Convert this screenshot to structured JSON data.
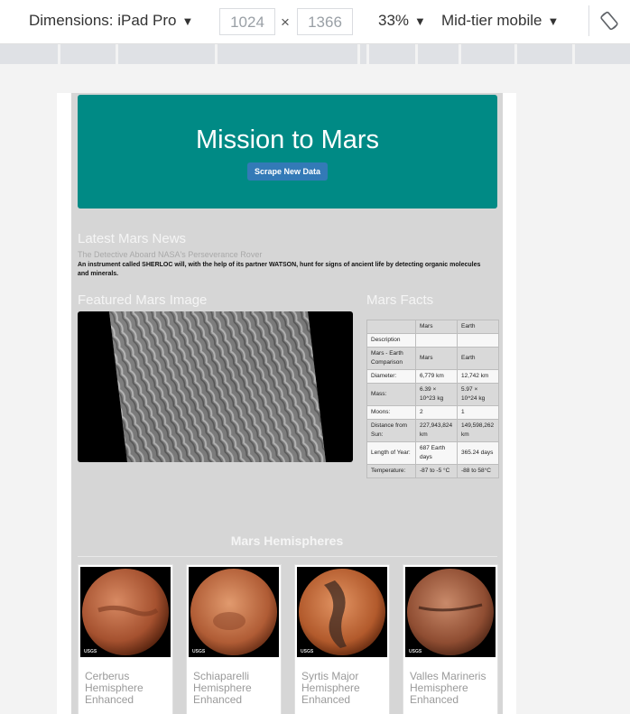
{
  "toolbar": {
    "dimensions_label": "Dimensions: iPad Pro",
    "width_value": "1024",
    "times_symbol": "×",
    "height_value": "1366",
    "zoom": "33%",
    "throttle": "Mid-tier mobile",
    "icons": {
      "dropdown": "chevron-down-icon",
      "rotate": "rotate-icon"
    }
  },
  "page": {
    "title": "Mission to Mars",
    "scrape_button": "Scrape New Data",
    "colors": {
      "jumbotron": "#008a85",
      "button": "#337ab7",
      "panel": "#d6d6d6"
    },
    "news": {
      "heading": "Latest Mars News",
      "title": "The Detective Aboard NASA's Perseverance Rover",
      "paragraph": "An instrument called SHERLOC will, with the help of its partner WATSON, hunt for signs of ancient life by detecting organic molecules and minerals."
    },
    "featured": {
      "heading": "Featured Mars Image"
    },
    "facts": {
      "heading": "Mars Facts",
      "columns": [
        "",
        "Mars",
        "Earth"
      ],
      "rows": [
        [
          "Description",
          "",
          ""
        ],
        [
          "Mars - Earth Comparison",
          "Mars",
          "Earth"
        ],
        [
          "Diameter:",
          "6,779 km",
          "12,742 km"
        ],
        [
          "Mass:",
          "6.39 × 10^23 kg",
          "5.97 × 10^24 kg"
        ],
        [
          "Moons:",
          "2",
          "1"
        ],
        [
          "Distance from Sun:",
          "227,943,824 km",
          "149,598,262 km"
        ],
        [
          "Length of Year:",
          "687 Earth days",
          "365.24 days"
        ],
        [
          "Temperature:",
          "-87 to -5 °C",
          "-88 to 58°C"
        ]
      ]
    },
    "hemispheres": {
      "heading": "Mars Hemispheres",
      "items": [
        {
          "title": "Cerberus Hemisphere Enhanced"
        },
        {
          "title": "Schiaparelli Hemisphere Enhanced"
        },
        {
          "title": "Syrtis Major Hemisphere Enhanced"
        },
        {
          "title": "Valles Marineris Hemisphere Enhanced"
        }
      ]
    }
  }
}
